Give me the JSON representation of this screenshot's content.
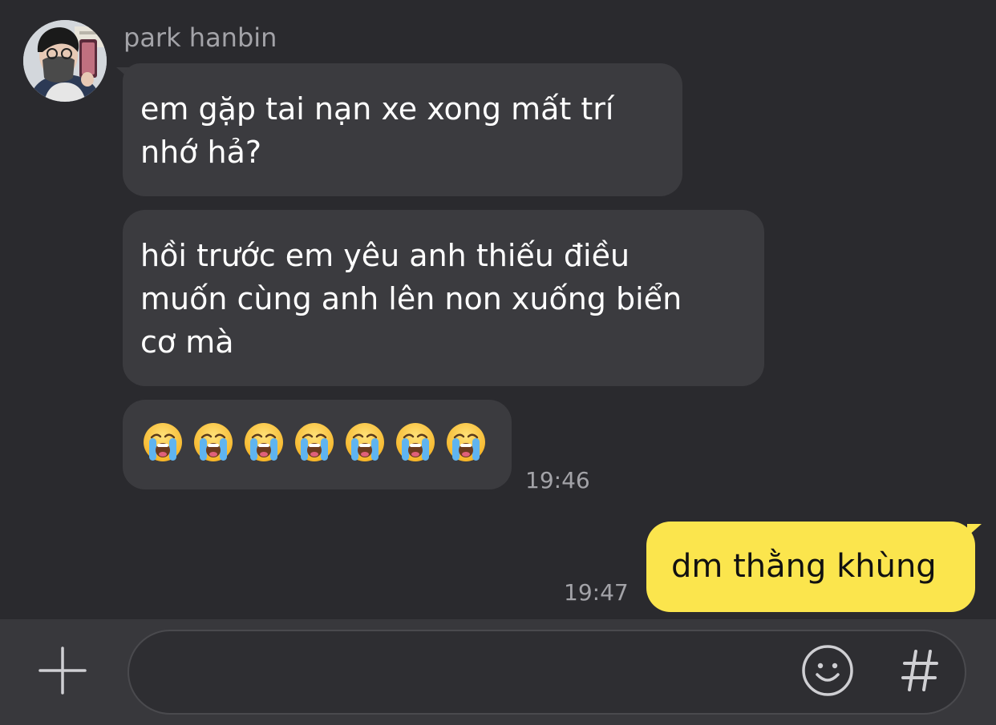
{
  "contact": {
    "name": "park hanbin"
  },
  "messages": {
    "incoming": [
      {
        "lines": [
          "em gặp tai nạn xe xong mất trí",
          "nhớ hả?"
        ]
      },
      {
        "lines": [
          "hồi trước em yêu anh thiếu điều",
          "muốn cùng anh lên non xuống biển",
          "cơ mà"
        ]
      },
      {
        "emoji": "loudly-crying-face",
        "count": 7
      }
    ],
    "incoming_time": "19:46",
    "outgoing": {
      "text": "dm thằng khùng",
      "time": "19:47"
    }
  },
  "composer": {
    "value": "",
    "icons": [
      "plus-icon",
      "smiley-icon",
      "hashtag-icon"
    ]
  },
  "colors": {
    "background": "#2a2a2e",
    "incoming_bubble": "#3b3b3f",
    "outgoing_bubble": "#fbe54d",
    "meta_text": "#a3a3a8"
  }
}
